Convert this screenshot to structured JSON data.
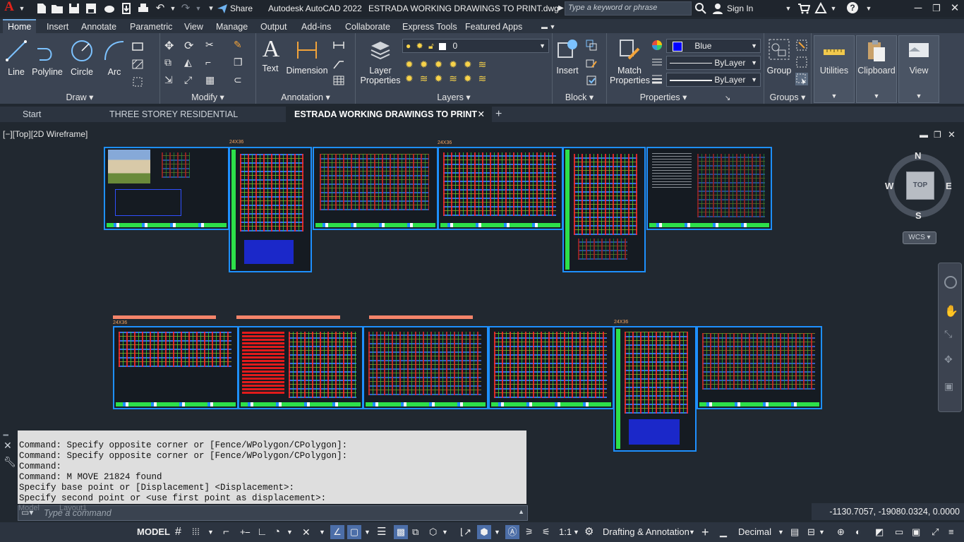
{
  "titlebar": {
    "share_label": "Share",
    "app_title": "Autodesk AutoCAD 2022",
    "file_title": "ESTRADA WORKING DRAWINGS TO PRINT.dwg",
    "search_placeholder": "Type a keyword or phrase",
    "sign_in_label": "Sign In"
  },
  "ribbon_tabs": [
    "Home",
    "Insert",
    "Annotate",
    "Parametric",
    "View",
    "Manage",
    "Output",
    "Add-ins",
    "Collaborate",
    "Express Tools",
    "Featured Apps"
  ],
  "ribbon": {
    "draw": {
      "title": "Draw",
      "line": "Line",
      "polyline": "Polyline",
      "circle": "Circle",
      "arc": "Arc"
    },
    "modify": {
      "title": "Modify"
    },
    "annotation": {
      "title": "Annotation",
      "text": "Text",
      "dimension": "Dimension"
    },
    "layers": {
      "title": "Layers",
      "layer_properties_1": "Layer",
      "layer_properties_2": "Properties",
      "current_layer": "0"
    },
    "block": {
      "title": "Block",
      "insert": "Insert"
    },
    "properties": {
      "title": "Properties",
      "match_1": "Match",
      "match_2": "Properties",
      "color": "Blue",
      "linetype": "ByLayer",
      "lineweight": "ByLayer"
    },
    "groups": {
      "title": "Groups",
      "group": "Group"
    },
    "utilities": "Utilities",
    "clipboard": "Clipboard",
    "view": "View"
  },
  "file_tabs": {
    "start": "Start",
    "tab1": "THREE STOREY RESIDENTIAL APARTMENT*",
    "tab2": "ESTRADA WORKING DRAWINGS TO PRINT"
  },
  "viewport": {
    "label": "[−][Top][2D Wireframe]",
    "sheet_tag": "24X36",
    "compass": {
      "n": "N",
      "s": "S",
      "e": "E",
      "w": "W",
      "top": "TOP"
    },
    "wcs": "WCS"
  },
  "command_history": [
    "Command: Specify opposite corner or [Fence/WPolygon/CPolygon]:",
    "Command: Specify opposite corner or [Fence/WPolygon/CPolygon]:",
    "Command:",
    "Command: M MOVE 21824 found",
    "Specify base point or [Displacement] <Displacement>:",
    "Specify second point or <use first point as displacement>:"
  ],
  "command_placeholder": "Type a command",
  "layout_tabs": {
    "model": "Model",
    "layout1": "Layout1"
  },
  "coordinates": "-1130.7057, -19080.0324, 0.0000",
  "statusbar": {
    "model": "MODEL",
    "scale": "1:1",
    "workspace": "Drafting & Annotation",
    "units": "Decimal"
  },
  "colors": {
    "accent_blue": "#1e90ff",
    "brand_red": "#e2231a",
    "color_swatch": "#0000ff"
  }
}
